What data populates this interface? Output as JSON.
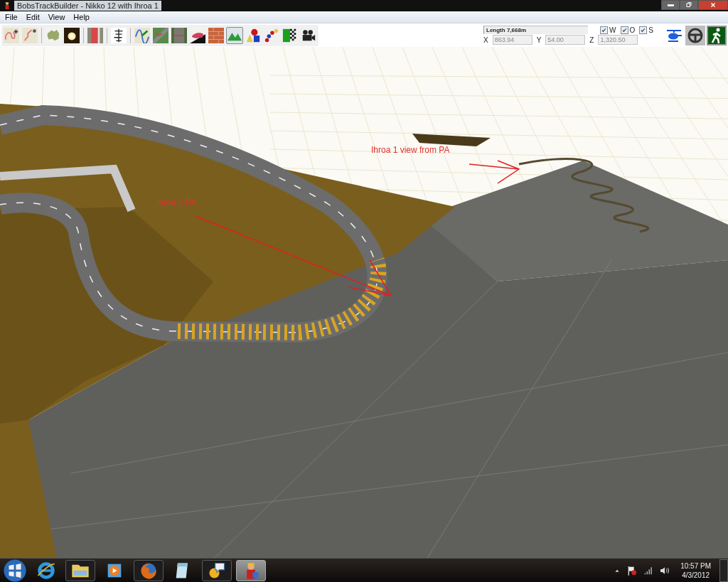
{
  "window": {
    "title": "BobsTrackBuilder - Nikko 12 with Ihroa 1"
  },
  "menu": [
    "File",
    "Edit",
    "View",
    "Help"
  ],
  "toolbar": {
    "groups": [
      [
        {
          "kind": "track-add",
          "selected": false
        },
        {
          "kind": "track-edit",
          "selected": false
        }
      ],
      [
        {
          "kind": "map",
          "selected": false
        },
        {
          "kind": "sun",
          "selected": false
        }
      ],
      [
        {
          "kind": "road-strip",
          "selected": false
        }
      ],
      [
        {
          "kind": "tree-line",
          "selected": false
        }
      ],
      [
        {
          "kind": "spline",
          "selected": false
        },
        {
          "kind": "road-cross",
          "selected": false
        },
        {
          "kind": "road-width",
          "selected": false
        },
        {
          "kind": "car",
          "selected": false
        },
        {
          "kind": "brick",
          "selected": false
        },
        {
          "kind": "mountain",
          "selected": true
        },
        {
          "kind": "shapes",
          "selected": false
        },
        {
          "kind": "beads",
          "selected": false
        },
        {
          "kind": "checker",
          "selected": false
        },
        {
          "kind": "camera",
          "selected": false
        }
      ]
    ]
  },
  "info": {
    "length": "Length 7,668m",
    "coords": [
      {
        "label": "X",
        "value": "863.94"
      },
      {
        "label": "Y",
        "value": "54.00"
      },
      {
        "label": "Z",
        "value": "1,320.50"
      }
    ],
    "toggles": [
      {
        "label": "W",
        "checked": true
      },
      {
        "label": "O",
        "checked": true
      },
      {
        "label": "S",
        "checked": true
      }
    ]
  },
  "modes": [
    {
      "kind": "helicopter",
      "selected": false
    },
    {
      "kind": "wheel",
      "selected": false
    },
    {
      "kind": "walker",
      "selected": true
    }
  ],
  "viewport": {
    "annotations": [
      {
        "kind": "far",
        "text": "Ihroa 1 view from PA"
      },
      {
        "kind": "near",
        "text": "Ihroa 2 PA"
      }
    ]
  },
  "taskbar": {
    "apps": [
      {
        "kind": "browser-e",
        "running": false,
        "selected": false
      },
      {
        "kind": "folder",
        "running": true,
        "selected": false
      },
      {
        "kind": "media",
        "running": false,
        "selected": false
      },
      {
        "kind": "firefox",
        "running": true,
        "selected": false
      },
      {
        "kind": "notepad",
        "running": false,
        "selected": false
      },
      {
        "kind": "chat",
        "running": true,
        "selected": false
      },
      {
        "kind": "builder",
        "running": true,
        "selected": true
      }
    ],
    "clock": {
      "time": "10:57 PM",
      "date": "4/3/2012"
    }
  }
}
